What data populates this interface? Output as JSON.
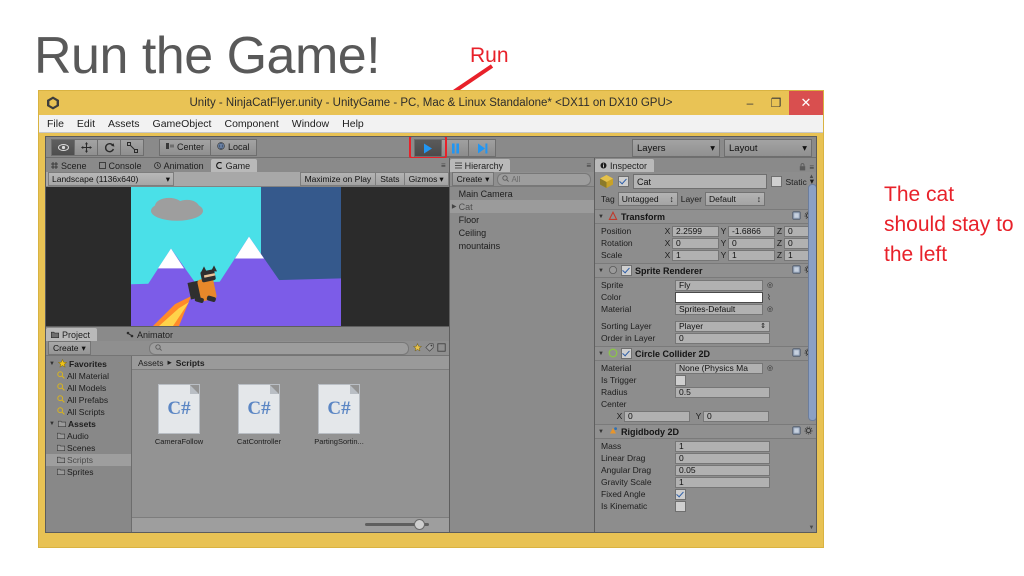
{
  "slide": {
    "title": "Run the Game!",
    "annotation_run": "Run",
    "annotation_cat": "The cat should stay to the left",
    "annotation_color": "#e8212a"
  },
  "window": {
    "title": "Unity - NinjaCatFlyer.unity - UnityGame - PC, Mac & Linux Standalone* <DX11 on DX10 GPU>",
    "minimize": "–",
    "maximize": "❐",
    "close": "✕",
    "logo_icon": "unity-logo-icon",
    "titlebar_color": "#e9c355"
  },
  "menubar": {
    "items": [
      "File",
      "Edit",
      "Assets",
      "GameObject",
      "Component",
      "Window",
      "Help"
    ]
  },
  "toolbar": {
    "transform_tools": [
      {
        "name": "hand-tool",
        "glyph": "✋"
      },
      {
        "name": "move-tool",
        "glyph": "✥"
      },
      {
        "name": "rotate-tool",
        "glyph": "↻"
      },
      {
        "name": "scale-tool",
        "glyph": "⤢"
      }
    ],
    "pivot_label": "Center",
    "space_label": "Local",
    "play_label": "▶",
    "pause_label": "Ⅱ",
    "step_label": "▶|",
    "layers_label": "Layers",
    "layout_label": "Layout",
    "dropdown_arrow": "▾"
  },
  "game_view": {
    "tabs": [
      {
        "label": "Scene",
        "icon": "grid-icon",
        "active": false
      },
      {
        "label": "Console",
        "icon": "console-icon",
        "active": false
      },
      {
        "label": "Animation",
        "icon": "clock-icon",
        "active": false
      },
      {
        "label": "Game",
        "icon": "game-icon",
        "active": true
      }
    ],
    "aspect": "Landscape (1136x640)",
    "maximize_on_play": "Maximize on Play",
    "stats": "Stats",
    "gizmos": "Gizmos",
    "tab_menu": "≡"
  },
  "project": {
    "tabs": [
      {
        "label": "Project",
        "icon": "folder-icon",
        "active": true
      },
      {
        "label": "Animator",
        "icon": "animator-icon",
        "active": false
      }
    ],
    "create_label": "Create",
    "search_placeholder": "",
    "search_icon": "search-icon",
    "tree": [
      {
        "label": "Favorites",
        "icon": "star-icon",
        "level": 0,
        "bold": true,
        "selected": false
      },
      {
        "label": "All Material",
        "icon": "search-icon",
        "level": 1,
        "bold": false,
        "selected": false
      },
      {
        "label": "All Models",
        "icon": "search-icon",
        "level": 1,
        "bold": false,
        "selected": false
      },
      {
        "label": "All Prefabs",
        "icon": "search-icon",
        "level": 1,
        "bold": false,
        "selected": false
      },
      {
        "label": "All Scripts",
        "icon": "search-icon",
        "level": 1,
        "bold": false,
        "selected": false
      },
      {
        "label": "Assets",
        "icon": "folder-icon",
        "level": 0,
        "bold": true,
        "selected": false
      },
      {
        "label": "Audio",
        "icon": "folder-icon",
        "level": 1,
        "bold": false,
        "selected": false
      },
      {
        "label": "Scenes",
        "icon": "folder-icon",
        "level": 1,
        "bold": false,
        "selected": false
      },
      {
        "label": "Scripts",
        "icon": "folder-icon",
        "level": 1,
        "bold": false,
        "selected": true
      },
      {
        "label": "Sprites",
        "icon": "folder-icon",
        "level": 1,
        "bold": false,
        "selected": false
      }
    ],
    "breadcrumb": [
      "Assets",
      "Scripts"
    ],
    "breadcrumb_sep": "▸",
    "assets": [
      {
        "label": "CameraFollow",
        "icon": "csharp-script-icon",
        "glyph": "C#"
      },
      {
        "label": "CatController",
        "icon": "csharp-script-icon",
        "glyph": "C#"
      },
      {
        "label": "PartingSortin...",
        "icon": "csharp-script-icon",
        "glyph": "C#"
      }
    ]
  },
  "hierarchy": {
    "tab_label": "Hierarchy",
    "tab_icon": "hierarchy-icon",
    "create_label": "Create",
    "search_placeholder": "All",
    "search_icon": "search-icon",
    "items": [
      {
        "label": "Main Camera",
        "selected": false,
        "expandable": false
      },
      {
        "label": "Cat",
        "selected": true,
        "expandable": true
      },
      {
        "label": "Floor",
        "selected": false,
        "expandable": false
      },
      {
        "label": "Ceiling",
        "selected": false,
        "expandable": false
      },
      {
        "label": "mountains",
        "selected": false,
        "expandable": false
      }
    ],
    "expand_arrow": "▶"
  },
  "inspector": {
    "tab_label": "Inspector",
    "tab_icon": "info-icon",
    "lock_icon": "lock-icon",
    "menu_icon": "≡",
    "object_name": "Cat",
    "enabled": true,
    "static_label": "Static",
    "static_checked": false,
    "tag_label": "Tag",
    "tag_value": "Untagged",
    "layer_label": "Layer",
    "layer_value": "Default",
    "select_arrow": "↕",
    "dropdown_arrow": "▾",
    "components": [
      {
        "name": "Transform",
        "icon": "transform-icon",
        "has_checkbox": false,
        "enabled": true,
        "rows": [
          {
            "label": "Position",
            "type": "vector3",
            "x": "2.2599",
            "y": "-1.6866",
            "z": "0"
          },
          {
            "label": "Rotation",
            "type": "vector3",
            "x": "0",
            "y": "0",
            "z": "0"
          },
          {
            "label": "Scale",
            "type": "vector3",
            "x": "1",
            "y": "1",
            "z": "1"
          }
        ]
      },
      {
        "name": "Sprite Renderer",
        "icon": "sprite-renderer-icon",
        "has_checkbox": true,
        "enabled": true,
        "rows": [
          {
            "label": "Sprite",
            "type": "object",
            "value": "Fly"
          },
          {
            "label": "Color",
            "type": "color",
            "value": "#ffffff"
          },
          {
            "label": "Material",
            "type": "object",
            "value": "Sprites-Default"
          },
          {
            "label": "",
            "type": "spacer",
            "value": ""
          },
          {
            "label": "Sorting Layer",
            "type": "select",
            "value": "Player"
          },
          {
            "label": "Order in Layer",
            "type": "text",
            "value": "0"
          }
        ]
      },
      {
        "name": "Circle Collider 2D",
        "icon": "circle-collider-icon",
        "has_checkbox": true,
        "enabled": true,
        "rows": [
          {
            "label": "Material",
            "type": "object",
            "value": "None (Physics Ma"
          },
          {
            "label": "Is Trigger",
            "type": "checkbox",
            "value": false
          },
          {
            "label": "Radius",
            "type": "text",
            "value": "0.5"
          },
          {
            "label": "Center",
            "type": "label",
            "value": ""
          },
          {
            "label": "",
            "type": "vector2",
            "x": "0",
            "y": "0"
          }
        ]
      },
      {
        "name": "Rigidbody 2D",
        "icon": "rigidbody-icon",
        "has_checkbox": false,
        "enabled": true,
        "rows": [
          {
            "label": "Mass",
            "type": "text",
            "value": "1"
          },
          {
            "label": "Linear Drag",
            "type": "text",
            "value": "0"
          },
          {
            "label": "Angular Drag",
            "type": "text",
            "value": "0.05"
          },
          {
            "label": "Gravity Scale",
            "type": "text",
            "value": "1"
          },
          {
            "label": "Fixed Angle",
            "type": "checkbox",
            "value": true
          },
          {
            "label": "Is Kinematic",
            "type": "checkbox",
            "value": false
          }
        ]
      }
    ]
  }
}
